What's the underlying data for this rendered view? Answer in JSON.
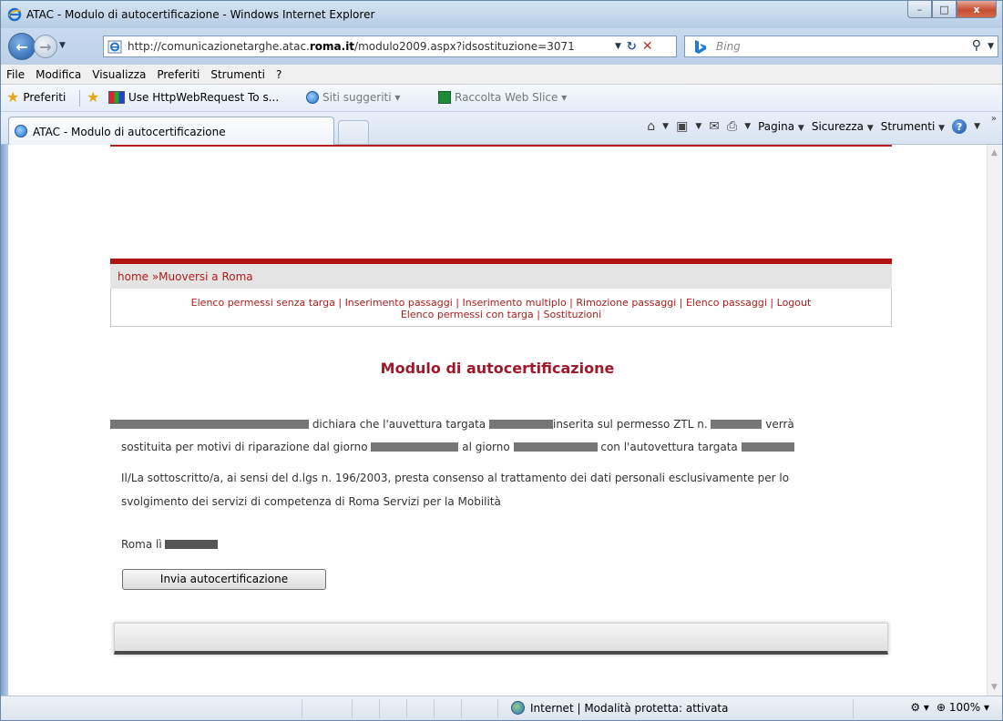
{
  "window": {
    "title": "ATAC - Modulo di autocertificazione - Windows Internet Explorer",
    "min_label": "–",
    "max_label": "□",
    "close_label": "x"
  },
  "address": {
    "url_prefix": "http://comunicazionetarghe.atac.",
    "url_bold": "roma.it",
    "url_suffix": "/modulo2009.aspx?idsostituzione=3071",
    "search_placeholder": "Bing"
  },
  "menubar": {
    "items": [
      "File",
      "Modifica",
      "Visualizza",
      "Preferiti",
      "Strumenti",
      "?"
    ]
  },
  "favorites": {
    "preferiti_label": "Preferiti",
    "links": [
      {
        "label": "Use HttpWebRequest To s..."
      },
      {
        "label": "Siti suggeriti ▾"
      },
      {
        "label": "Raccolta Web Slice ▾"
      }
    ]
  },
  "tabs": {
    "active_label": "ATAC - Modulo di autocertificazione"
  },
  "commandbar": {
    "pagina": "Pagina",
    "sicurezza": "Sicurezza",
    "strumenti": "Strumenti",
    "overflow": "»"
  },
  "page": {
    "breadcrumb": "home  »Muoversi a Roma",
    "menu_row1": [
      "Elenco permessi senza targa",
      "Inserimento passaggi",
      "Inserimento multiplo",
      "Rimozione passaggi",
      "Elenco passaggi",
      "Logout"
    ],
    "menu_row2": [
      "Elenco permessi con targa",
      "Sostituzioni"
    ],
    "heading": "Modulo di autocertificazione",
    "line1_a": " dichiara che l'auvettura targata ",
    "line1_b": "inserita sul permesso ZTL n. ",
    "line1_c": " verrà",
    "line2_a": "sostituita per motivi di riparazione dal giorno ",
    "line2_b": " al giorno ",
    "line2_c": " con l'autovettura targata ",
    "consent_1": "Il/La sottoscritto/a, ai sensi del d.lgs n. 196/2003, presta consenso al trattamento dei dati personali esclusivamente per lo",
    "consent_2": "svolgimento dei servizi di competenza di  Roma Servizi per la Mobilità",
    "place_label": "Roma lì ",
    "submit_label": "Invia autocertificazione"
  },
  "status": {
    "zone": "Internet | Modalità protetta: attivata",
    "zoom": "100%"
  }
}
